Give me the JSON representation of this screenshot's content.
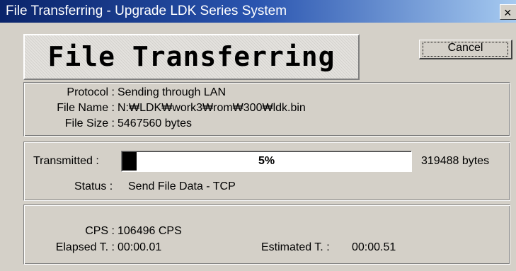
{
  "window": {
    "title": "File Transferring - Upgrade LDK Series System",
    "close_glyph": "×"
  },
  "banner": {
    "text": "File Transferring"
  },
  "buttons": {
    "cancel": "Cancel"
  },
  "file_info": {
    "protocol_label": "Protocol :",
    "protocol_value": "Sending through LAN",
    "filename_label": "File Name :",
    "filename_value": "N:₩LDK₩work3₩rom₩300₩ldk.bin",
    "filesize_label": "File Size :",
    "filesize_value": "5467560 bytes"
  },
  "transfer": {
    "transmitted_label": "Transmitted :",
    "progress_percent": 5,
    "progress_text": "5%",
    "bytes_text": "319488 bytes",
    "status_label": "Status :",
    "status_value": "Send File Data - TCP"
  },
  "stats": {
    "cps_label": "CPS :",
    "cps_value": "106496 CPS",
    "elapsed_label": "Elapsed T. :",
    "elapsed_value": "00:00.01",
    "estimated_label": "Estimated T. :",
    "estimated_value": "00:00.51"
  },
  "colors": {
    "titlebar_start": "#0a246a",
    "titlebar_end": "#a6caf0",
    "face": "#d4d0c8",
    "progress_fill": "#000000"
  }
}
